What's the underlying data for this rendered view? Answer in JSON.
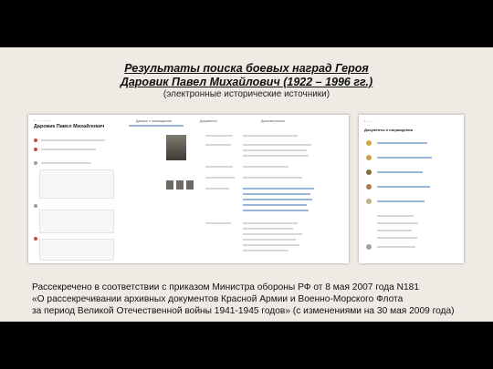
{
  "title_line1": "Результаты поиска боевых наград Героя",
  "title_line2": "Даровик Павел Михайлович (1922 – 1996 гг.)",
  "subtitle": "(электронные исторические источники)",
  "screenshot_left": {
    "person_name": "Даровик Павел Михайлович",
    "tab_awards": "Данные о награждении",
    "tab_documents": "Документы",
    "tab_more": "Дополнительно"
  },
  "screenshot_right": {
    "section_title": "Документы о награждении"
  },
  "note_line1": "Рассекречено в соответствии с приказом Министра обороны РФ от 8 мая 2007 года N181",
  "note_line2": "«О рассекречивании архивных документов Красной Армии и Военно-Морского Флота",
  "note_line3": "за период Великой Отечественной войны 1941-1945 годов» (с изменениями на 30 мая 2009 года)",
  "colors": {
    "slide_bg": "#efeae4",
    "frame_bg": "#000000",
    "accent_red": "#c9493b"
  }
}
